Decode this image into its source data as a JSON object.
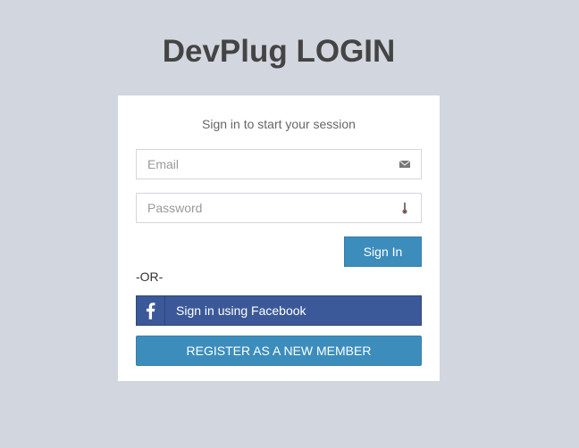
{
  "header": {
    "title": "DevPlug LOGIN"
  },
  "login_box": {
    "message": "Sign in to start your session",
    "email": {
      "placeholder": "Email",
      "value": "",
      "icon": "envelope-icon"
    },
    "password": {
      "placeholder": "Password",
      "value": "",
      "icon": "lock-icon"
    },
    "sign_in_label": "Sign In",
    "or_text": "-OR-",
    "facebook": {
      "label": "Sign in using Facebook",
      "icon": "facebook-icon"
    },
    "register_label": "REGISTER AS A NEW MEMBER"
  },
  "colors": {
    "background": "#d2d6de",
    "primary": "#3c8dbc",
    "facebook": "#3b5998"
  }
}
